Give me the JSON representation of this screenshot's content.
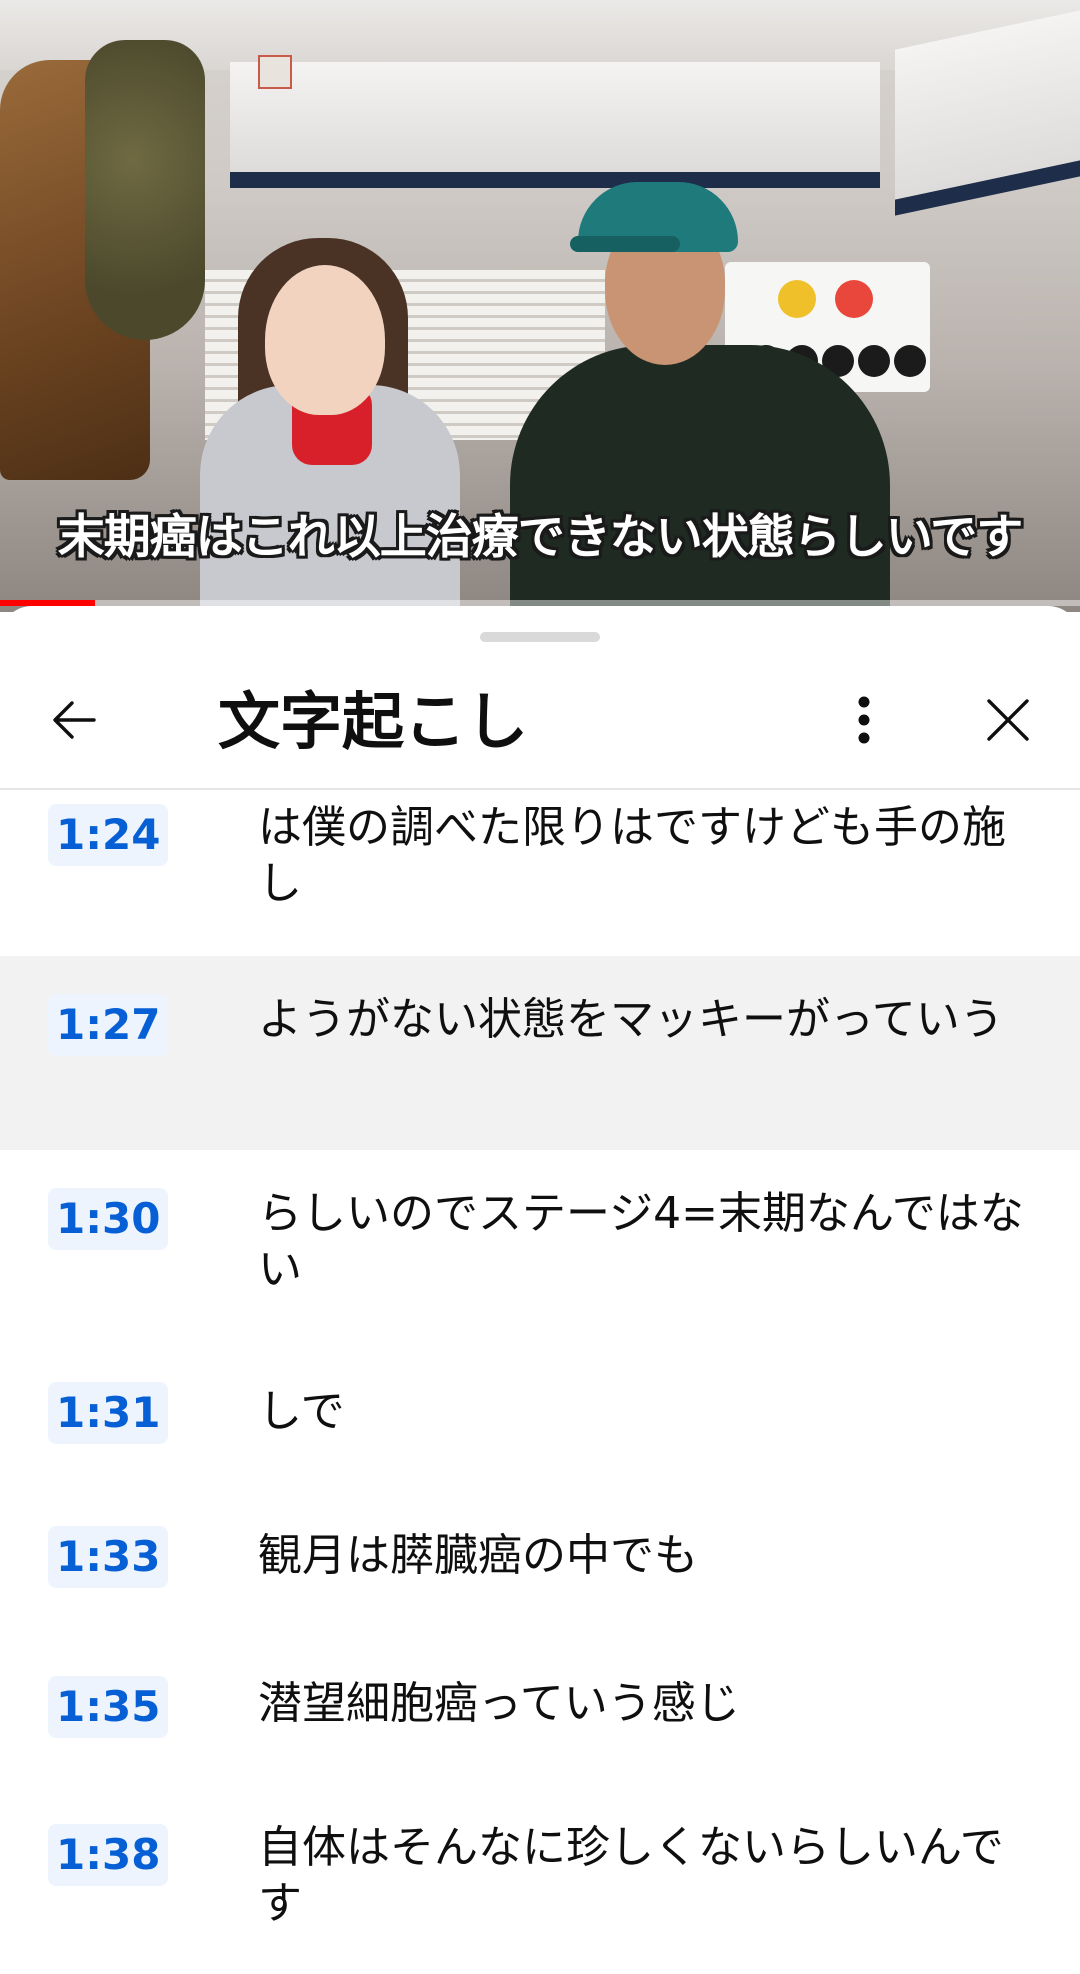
{
  "video": {
    "caption": "末期癌はこれ以上治療できない状態らしいです",
    "progress_fraction": 0.088
  },
  "panel": {
    "title": "文字起こし",
    "back_icon": "arrow-left-icon",
    "more_icon": "more-vert-icon",
    "close_icon": "close-icon"
  },
  "segments": [
    {
      "time": "1:24",
      "text": "は僕の調べた限りはですけども手の施し",
      "active": false
    },
    {
      "time": "1:27",
      "text": "ようがない状態をマッキーがっていう",
      "active": true
    },
    {
      "time": "1:30",
      "text": "らしいのでステージ4=末期なんではない",
      "active": false
    },
    {
      "time": "1:31",
      "text": "しで",
      "active": false
    },
    {
      "time": "1:33",
      "text": "観月は膵臓癌の中でも",
      "active": false
    },
    {
      "time": "1:35",
      "text": "潜望細胞癌っていう感じ",
      "active": false
    },
    {
      "time": "1:38",
      "text": "自体はそんなに珍しくないらしいんです",
      "active": false
    }
  ],
  "colors": {
    "timestamp_text": "#065fd4",
    "timestamp_bg": "#eef4fd",
    "active_row_bg": "#f2f2f2",
    "progress_played": "#ff0000"
  }
}
